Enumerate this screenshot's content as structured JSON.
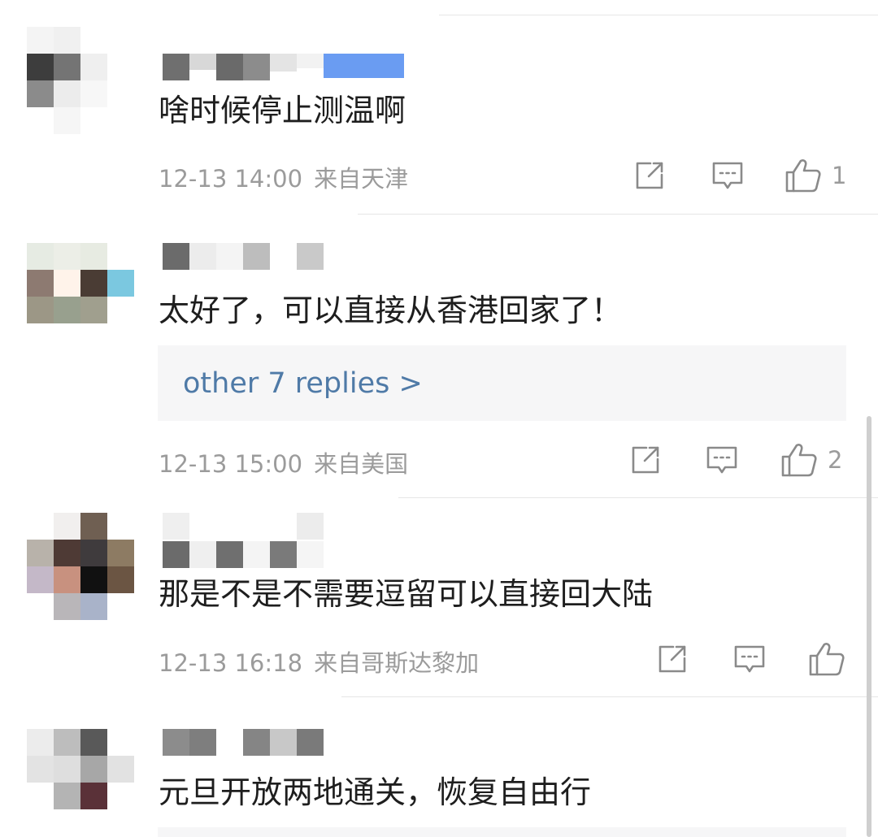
{
  "comments": [
    {
      "text": "啥时候停止测温啊",
      "time": "12-13 14:00",
      "location": "来自天津",
      "likes": "1"
    },
    {
      "text": "太好了，可以直接从香港回家了！",
      "replies_link": "other 7 replies >",
      "time": "12-13 15:00",
      "location": "来自美国",
      "likes": "2"
    },
    {
      "text": "那是不是不需要逗留可以直接回大陆",
      "time": "12-13 16:18",
      "location": "来自哥斯达黎加",
      "likes": ""
    },
    {
      "text": "元旦开放两地通关，恢复自由行"
    }
  ],
  "icons": {
    "share": "share-icon",
    "reply": "comment-icon",
    "like": "thumbs-up-icon"
  },
  "colors": {
    "link": "#4f7aa7",
    "meta_text": "#9b9b9b",
    "reply_box_bg": "#f6f6f7"
  }
}
